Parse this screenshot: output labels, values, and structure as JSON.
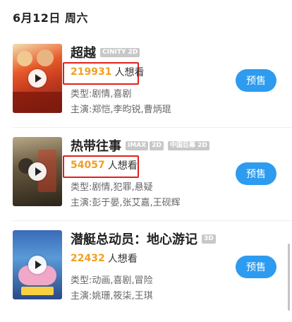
{
  "date_header": "6月12日 周六",
  "movies": [
    {
      "title": "超越",
      "tags": [
        "CINITY 2D"
      ],
      "want_count": "219931",
      "want_label": "人想看",
      "genre": "类型:剧情,喜剧",
      "cast": "主演:郑恺,李昀锐,曹炳琨",
      "buy_label": "预售"
    },
    {
      "title": "热带往事",
      "tags": [
        "IMAX",
        "2D",
        "中国巨幕 2D"
      ],
      "want_count": "54057",
      "want_label": "人想看",
      "genre": "类型:剧情,犯罪,悬疑",
      "cast": "主演:彭于晏,张艾嘉,王砚辉",
      "buy_label": "预售"
    },
    {
      "title": "潜艇总动员：地心游记",
      "tags": [
        "3D"
      ],
      "want_count": "22432",
      "want_label": "人想看",
      "genre": "类型:动画,喜剧,冒险",
      "cast": "主演:姚珊,筱柒,王琪",
      "buy_label": "预售"
    }
  ],
  "colors": {
    "accent": "#2d9bf0",
    "want_count": "#f0a020",
    "highlight_border": "#e0201e"
  }
}
